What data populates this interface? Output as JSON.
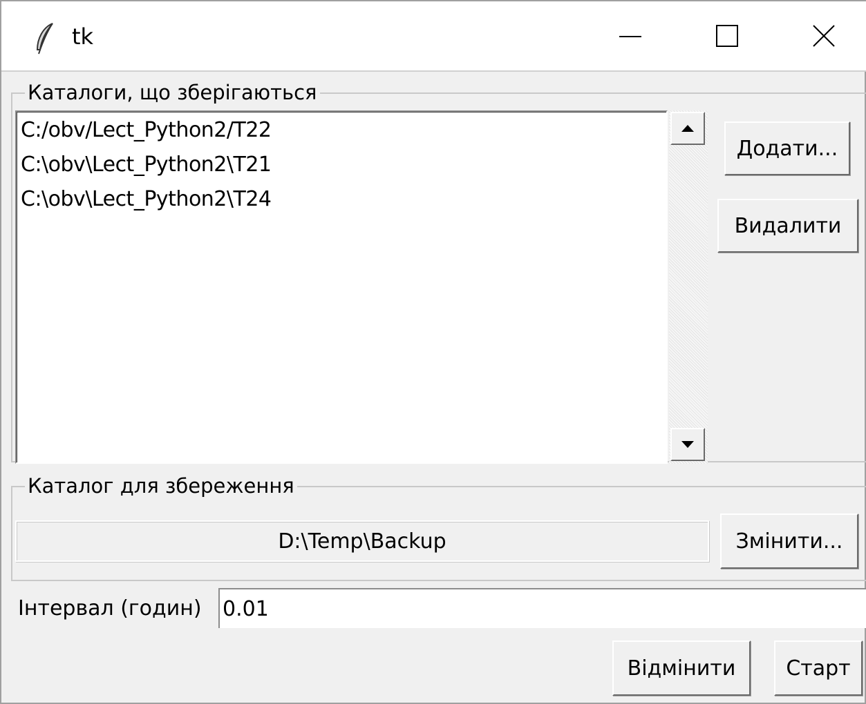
{
  "window": {
    "title": "tk",
    "icon": "feather-icon"
  },
  "sources": {
    "legend": "Каталоги, що зберігаються",
    "items": [
      "C:/obv/Lect_Python2/T22",
      "C:\\obv\\Lect_Python2\\T21",
      "C:\\obv\\Lect_Python2\\T24"
    ],
    "add_label": "Додати...",
    "delete_label": "Видалити"
  },
  "destination": {
    "legend": "Каталог для збереження",
    "path": "D:\\Temp\\Backup",
    "change_label": "Змінити..."
  },
  "interval": {
    "label": "Інтервал (годин)",
    "value": "0.01"
  },
  "actions": {
    "cancel_label": "Відмінити",
    "start_label": "Старт"
  }
}
